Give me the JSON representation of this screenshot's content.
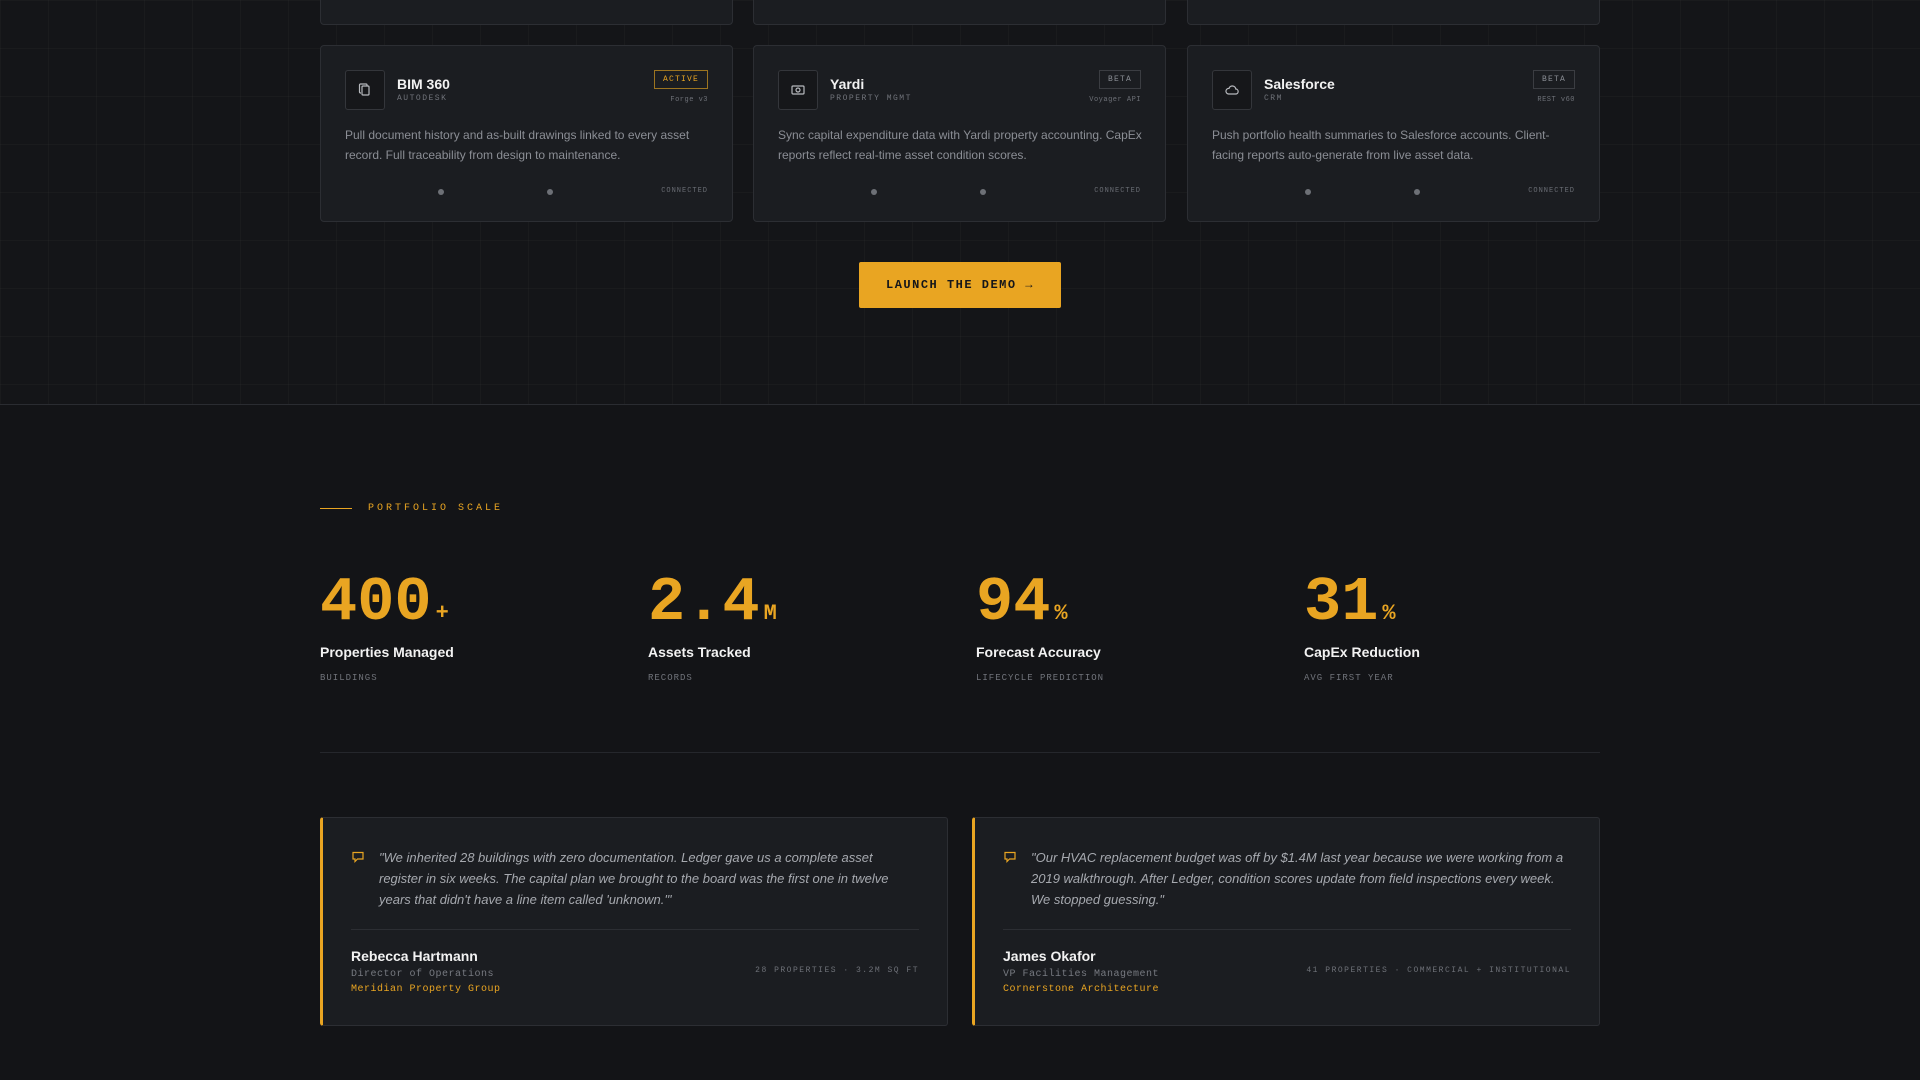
{
  "integrations": [
    {
      "name": "BIM 360",
      "vendor": "AUTODESK",
      "badge": "ACTIVE",
      "api": "Forge v3",
      "description": "Pull document history and as-built drawings linked to every asset record. Full traceability from design to maintenance.",
      "status": "CONNECTED",
      "icon": "documents-icon"
    },
    {
      "name": "Yardi",
      "vendor": "PROPERTY MGMT",
      "badge": "BETA",
      "api": "Voyager API",
      "description": "Sync capital expenditure data with Yardi property accounting. CapEx reports reflect real-time asset condition scores.",
      "status": "CONNECTED",
      "icon": "money-icon"
    },
    {
      "name": "Salesforce",
      "vendor": "CRM",
      "badge": "BETA",
      "api": "REST v60",
      "description": "Push portfolio health summaries to Salesforce accounts. Client-facing reports auto-generate from live asset data.",
      "status": "CONNECTED",
      "icon": "cloud-icon"
    }
  ],
  "cta": {
    "label": "LAUNCH THE DEMO →"
  },
  "scale": {
    "eyebrow": "PORTFOLIO SCALE",
    "stats": [
      {
        "value": "400",
        "suffix": "+",
        "label": "Properties Managed",
        "sub": "BUILDINGS"
      },
      {
        "value": "2.4",
        "suffix": "M",
        "label": "Assets Tracked",
        "sub": "RECORDS"
      },
      {
        "value": "94",
        "suffix": "%",
        "label": "Forecast Accuracy",
        "sub": "LIFECYCLE PREDICTION"
      },
      {
        "value": "31",
        "suffix": "%",
        "label": "CapEx Reduction",
        "sub": "AVG FIRST YEAR"
      }
    ]
  },
  "testimonials": [
    {
      "quote": "\"We inherited 28 buildings with zero documentation. Ledger gave us a complete asset register in six weeks. The capital plan we brought to the board was the first one in twelve years that didn't have a line item called 'unknown.'\"",
      "name": "Rebecca Hartmann",
      "role": "Director of Operations",
      "org": "Meridian Property Group",
      "meta": "28 PROPERTIES · 3.2M SQ FT"
    },
    {
      "quote": "\"Our HVAC replacement budget was off by $1.4M last year because we were working from a 2019 walkthrough. After Ledger, condition scores update from field inspections every week. We stopped guessing.\"",
      "name": "James Okafor",
      "role": "VP Facilities Management",
      "org": "Cornerstone Architecture",
      "meta": "41 PROPERTIES · COMMERCIAL + INSTITUTIONAL"
    }
  ],
  "colors": {
    "accent": "#e9a522",
    "background": "#131417",
    "card": "#1b1d21"
  }
}
